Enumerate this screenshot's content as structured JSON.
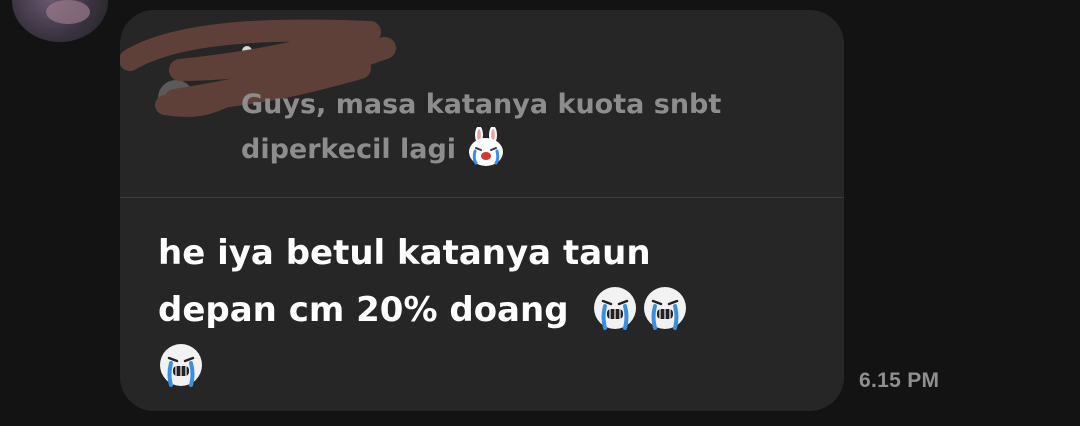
{
  "chat": {
    "background_color": "#131313",
    "bubble_color": "#262626",
    "incoming_message": {
      "reply": {
        "text": "Guys, masa katanya kuota snbt diperkecil lagi",
        "emoji": "crying-bunny-sticker-icon"
      },
      "body": {
        "text": "he iya betul katanya taun depan cm 20% doang",
        "emojis": [
          "crying-face-sticker-icon",
          "crying-face-sticker-icon",
          "crying-face-sticker-icon"
        ]
      },
      "timestamp": "6.15 PM"
    }
  }
}
